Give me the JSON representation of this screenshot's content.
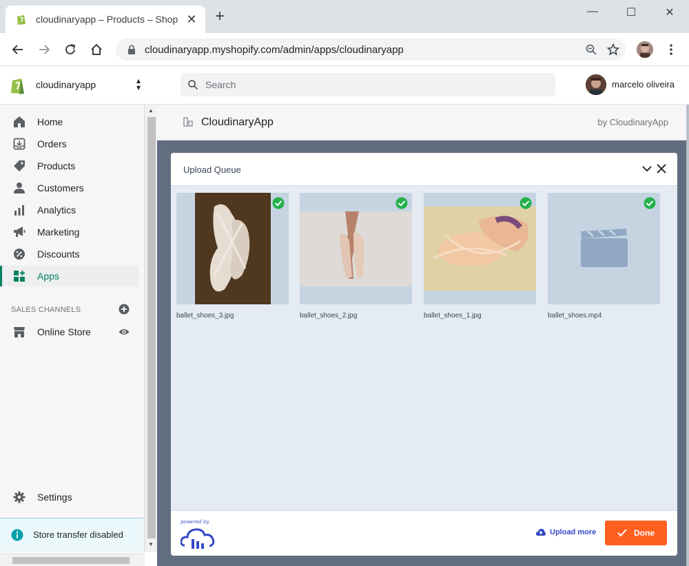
{
  "browser": {
    "tab_title": "cloudinaryapp – Products – Shop",
    "url": "cloudinaryapp.myshopify.com/admin/apps/cloudinaryapp",
    "icons": [
      "back-icon",
      "forward-icon",
      "reload-icon",
      "home-icon",
      "lock-icon",
      "zoom-icon",
      "star-icon",
      "menu-icon"
    ]
  },
  "shopify": {
    "store_name": "cloudinaryapp",
    "search_placeholder": "Search",
    "user_name": "marcelo oliveira",
    "brand_color": "#008060"
  },
  "sidebar": {
    "items": [
      {
        "label": "Home",
        "icon": "home-icon"
      },
      {
        "label": "Orders",
        "icon": "orders-icon"
      },
      {
        "label": "Products",
        "icon": "tag-icon"
      },
      {
        "label": "Customers",
        "icon": "person-icon"
      },
      {
        "label": "Analytics",
        "icon": "bar-chart-icon"
      },
      {
        "label": "Marketing",
        "icon": "megaphone-icon"
      },
      {
        "label": "Discounts",
        "icon": "discount-icon"
      },
      {
        "label": "Apps",
        "icon": "apps-icon",
        "active": true
      }
    ],
    "sales_channels_heading": "SALES CHANNELS",
    "online_store": "Online Store",
    "settings": "Settings",
    "transfer_notice": "Store transfer disabled"
  },
  "app": {
    "title": "CloudinaryApp",
    "by": "by CloudinaryApp"
  },
  "modal": {
    "title": "Upload Queue",
    "files": [
      {
        "name": "ballet_shoes_3.jpg",
        "status": "uploaded"
      },
      {
        "name": "ballet_shoes_2.jpg",
        "status": "uploaded"
      },
      {
        "name": "ballet_shoes_1.jpg",
        "status": "uploaded"
      },
      {
        "name": "ballet_shoes.mp4",
        "status": "uploaded"
      }
    ],
    "powered_by": "powered by",
    "upload_more": "Upload more",
    "done": "Done",
    "accent": "#ff5f1f",
    "link_color": "#3448c5"
  }
}
